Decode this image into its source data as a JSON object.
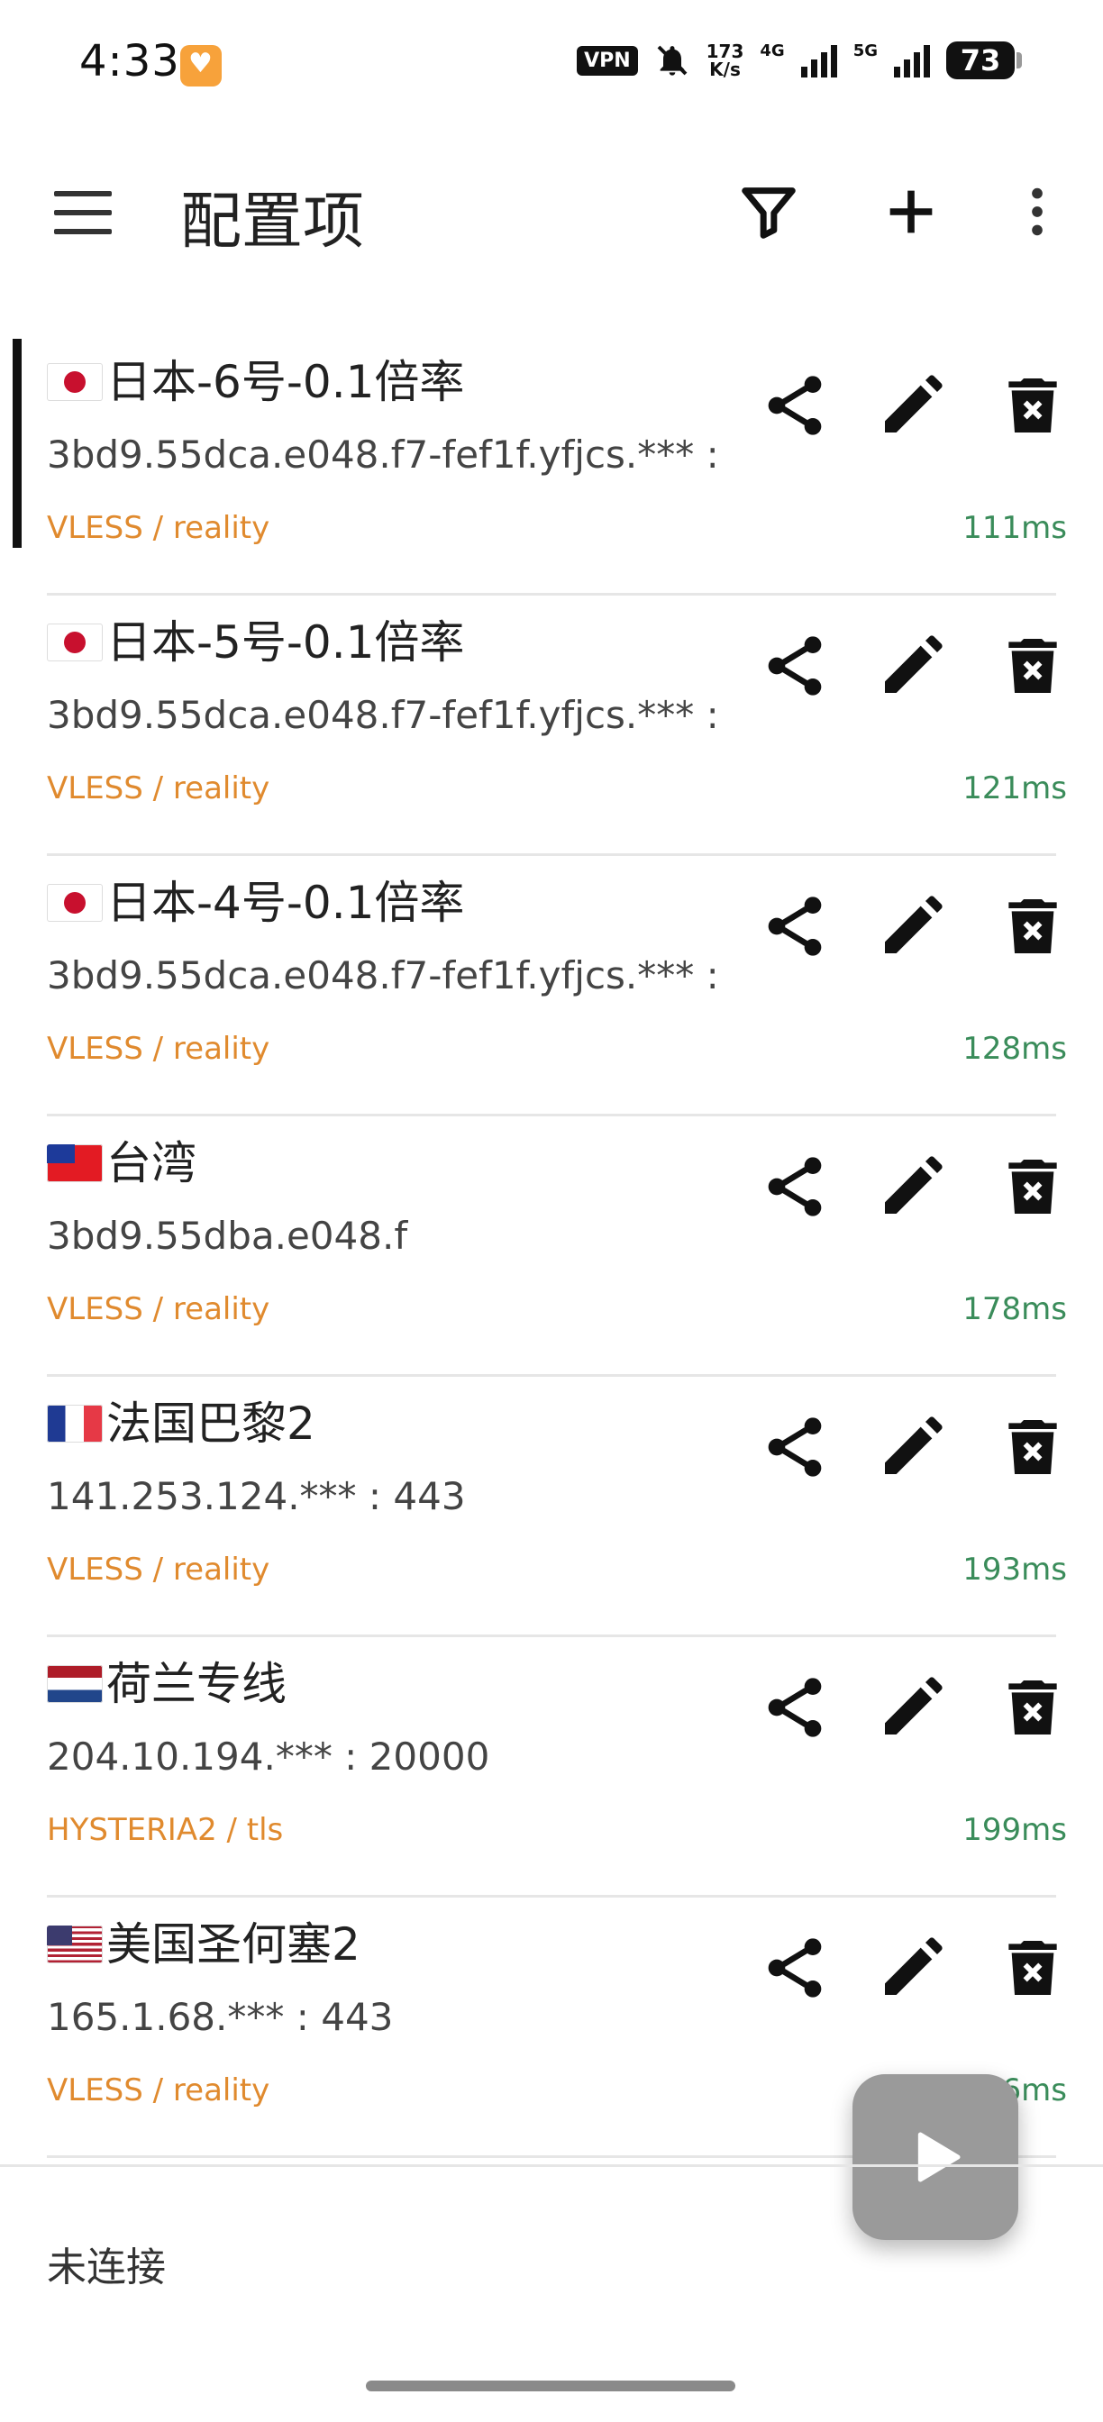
{
  "status_bar": {
    "time": "4:33",
    "vpn": "VPN",
    "speed_value": "173",
    "speed_unit": "K/s",
    "network_1": "4G",
    "network_2": "5G",
    "battery": "73"
  },
  "toolbar": {
    "title": "配置项",
    "menu_icon": "menu-icon",
    "filter_icon": "filter-icon",
    "add_icon": "add-icon",
    "more_icon": "more-vert-icon"
  },
  "servers": [
    {
      "flag": "jp",
      "name": "日本-6号-0.1倍率",
      "address": "3bd9.55dca.e048.f7-fef1f.yfjcs.*** :",
      "type": "VLESS / reality",
      "latency": "111ms",
      "selected": true
    },
    {
      "flag": "jp",
      "name": "日本-5号-0.1倍率",
      "address": "3bd9.55dca.e048.f7-fef1f.yfjcs.*** :",
      "type": "VLESS / reality",
      "latency": "121ms",
      "selected": false
    },
    {
      "flag": "jp",
      "name": "日本-4号-0.1倍率",
      "address": "3bd9.55dca.e048.f7-fef1f.yfjcs.*** :",
      "type": "VLESS / reality",
      "latency": "128ms",
      "selected": false
    },
    {
      "flag": "tw",
      "name": "台湾",
      "address": "3bd9.55dba.e048.f",
      "type": "VLESS / reality",
      "latency": "178ms",
      "selected": false
    },
    {
      "flag": "fr",
      "name": "法国巴黎2",
      "address": "141.253.124.*** : 443",
      "type": "VLESS / reality",
      "latency": "193ms",
      "selected": false
    },
    {
      "flag": "nl",
      "name": "荷兰专线",
      "address": "204.10.194.*** : 20000",
      "type": "HYSTERIA2 / tls",
      "latency": "199ms",
      "selected": false
    },
    {
      "flag": "us",
      "name": "美国圣何塞2",
      "address": "165.1.68.*** : 443",
      "type": "VLESS / reality",
      "latency": "216ms",
      "selected": false
    }
  ],
  "item_actions": {
    "share_icon": "share-icon",
    "edit_icon": "edit-icon",
    "delete_icon": "delete-icon"
  },
  "fab": {
    "icon": "play-icon"
  },
  "connection_status": "未连接",
  "colors": {
    "type_text": "#e08a2e",
    "latency_text": "#3a8c5a",
    "fab_background": "#9a9a9a",
    "selected_indicator": "#111111"
  }
}
